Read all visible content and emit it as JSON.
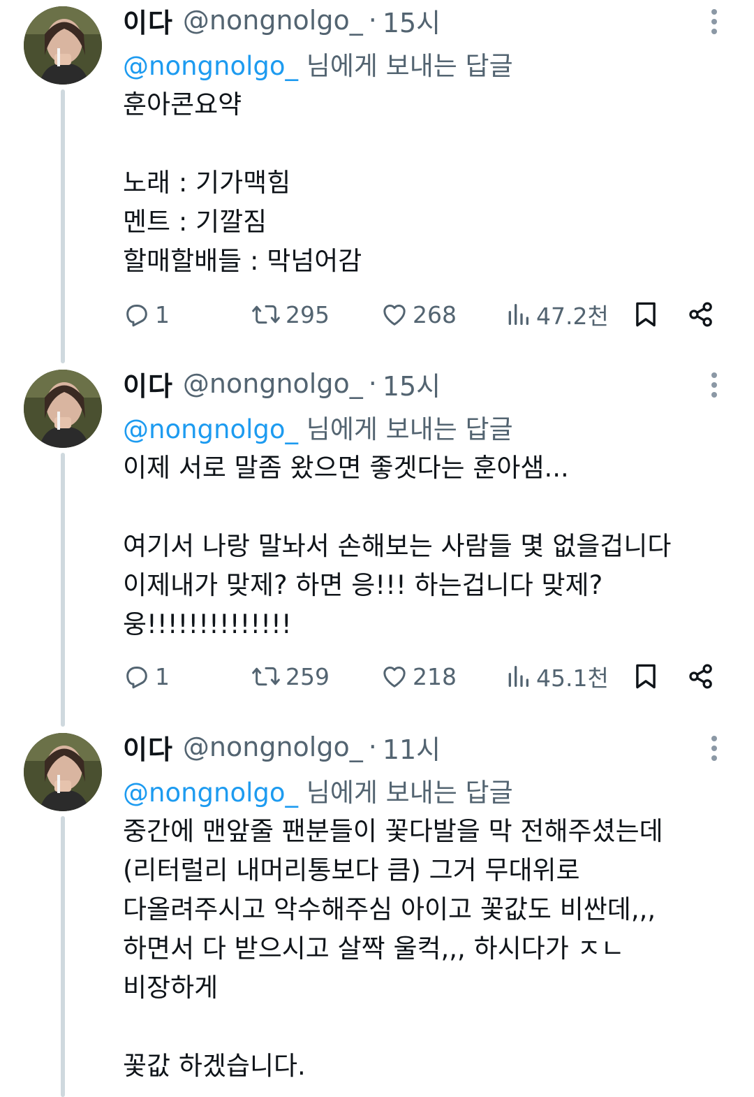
{
  "tweets": [
    {
      "name": "이다",
      "handle": "@nongnolgo_",
      "separator": "·",
      "time": "15시",
      "reply_mention": "@nongnolgo_",
      "reply_suffix": " 님에게 보내는 답글",
      "lines": [
        "훈아콘요약",
        "",
        "노래 : 기가맥힘",
        "멘트 : 기깔짐",
        "할매할배들 : 막넘어감"
      ],
      "replies": "1",
      "retweets": "295",
      "likes": "268",
      "views": "47.2천"
    },
    {
      "name": "이다",
      "handle": "@nongnolgo_",
      "separator": "·",
      "time": "15시",
      "reply_mention": "@nongnolgo_",
      "reply_suffix": " 님에게 보내는 답글",
      "lines": [
        "이제 서로 말좀 왔으면 좋겟다는 훈아샘...",
        "",
        "여기서 나랑 말놔서 손해보는 사람들 몇 없을겁니다",
        "이제내가 맞제? 하면 응!!! 하는겁니다 맞제?",
        "웅!!!!!!!!!!!!!!"
      ],
      "replies": "1",
      "retweets": "259",
      "likes": "218",
      "views": "45.1천"
    },
    {
      "name": "이다",
      "handle": "@nongnolgo_",
      "separator": "·",
      "time": "11시",
      "reply_mention": "@nongnolgo_",
      "reply_suffix": " 님에게 보내는 답글",
      "lines": [
        "중간에 맨앞줄 팬분들이 꽃다발을 막 전해주셨는데",
        "(리터럴리 내머리통보다 큼) 그거 무대위로",
        "다올려주시고 악수해주심 아이고 꽃값도 비싼데,,,",
        "하면서 다 받으시고 살짝 울컥,,, 하시다가 ㅈㄴ",
        "비장하게",
        "",
        "꽃값 하겠습니다."
      ]
    }
  ],
  "icons": {
    "reply": "reply-icon",
    "retweet": "retweet-icon",
    "like": "heart-icon",
    "views": "views-icon",
    "bookmark": "bookmark-icon",
    "share": "share-icon",
    "more": "more-icon"
  },
  "colors": {
    "text": "#0f1419",
    "secondary": "#536471",
    "mention": "#1d9bf0",
    "thread_line": "#cfd9de"
  }
}
